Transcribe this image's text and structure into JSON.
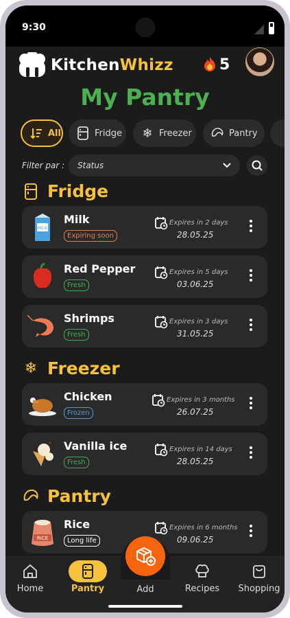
{
  "status_bar": {
    "time": "9:30"
  },
  "header": {
    "brand_part1": "Kitchen",
    "brand_part2": "Whizz",
    "streak_count": "5"
  },
  "page_title": "My Pantry",
  "chips": [
    {
      "label": "All",
      "icon": "sort-icon",
      "active": true
    },
    {
      "label": "Fridge",
      "icon": "fridge-icon"
    },
    {
      "label": "Freezer",
      "icon": "snowflake-icon"
    },
    {
      "label": "Pantry",
      "icon": "croissant-icon"
    }
  ],
  "filter": {
    "label": "Filter par :",
    "value": "Status"
  },
  "sections": [
    {
      "title": "Fridge",
      "icon": "fridge-icon",
      "items": [
        {
          "name": "Milk",
          "badge": "Expiring soon",
          "badge_color": "#e87d4c",
          "expires": "Expires in 2 days",
          "date": "28.05.25",
          "icon": "milk-carton-icon"
        },
        {
          "name": "Red Pepper",
          "badge": "Fresh",
          "badge_color": "#3fae54",
          "expires": "Expires in 5 days",
          "date": "03.06.25",
          "icon": "red-pepper-icon"
        },
        {
          "name": "Shrimps",
          "badge": "Fresh",
          "badge_color": "#3fae54",
          "expires": "Expires in 3 days",
          "date": "31.05.25",
          "icon": "shrimp-icon"
        }
      ]
    },
    {
      "title": "Freezer",
      "icon": "snowflake-icon",
      "items": [
        {
          "name": "Chicken",
          "badge": "Frozen",
          "badge_color": "#4f9cd8",
          "expires": "Expires in 3 months",
          "date": "26.07.25",
          "icon": "roast-chicken-icon"
        },
        {
          "name": "Vanilla ice",
          "badge": "Fresh",
          "badge_color": "#3fae54",
          "expires": "Expires in 14 days",
          "date": "28.05.25",
          "icon": "ice-cream-icon"
        }
      ]
    },
    {
      "title": "Pantry",
      "icon": "croissant-icon",
      "items": [
        {
          "name": "Rice",
          "badge": "Long life",
          "badge_color": "#ffffff",
          "expires": "Expires in 6 months",
          "date": "09.06.25",
          "icon": "rice-bag-icon"
        }
      ]
    }
  ],
  "bottom_nav": [
    {
      "label": "Home",
      "icon": "home-icon"
    },
    {
      "label": "Pantry",
      "icon": "fridge-icon",
      "active": true
    },
    {
      "label": "Add",
      "icon": "add-package-icon"
    },
    {
      "label": "Recipes",
      "icon": "chef-hat-icon"
    },
    {
      "label": "Shopping",
      "icon": "shopping-bag-icon"
    }
  ],
  "colors": {
    "accent": "#f6c13d",
    "title_green": "#4caf50",
    "fab_orange": "#f7640f",
    "background": "#1b1b1b"
  }
}
